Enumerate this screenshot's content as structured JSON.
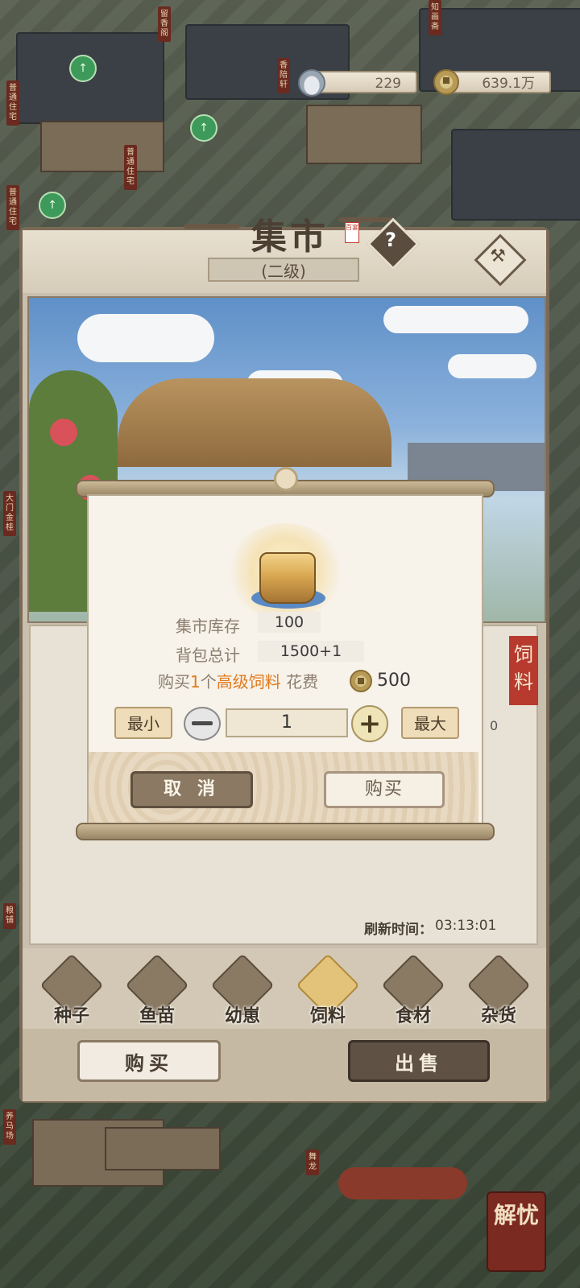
{
  "currency": {
    "silver": "229",
    "coins": "639.1万"
  },
  "map_signs": [
    "普通住宅",
    "普通住宅",
    "普通住宅",
    "香陪轩",
    "留香阁",
    "知画斋",
    "大门金桂",
    "粮铺",
    "养马场",
    "舞龙",
    "解忧"
  ],
  "market": {
    "title": "集市",
    "seal_text": "百宴",
    "level": "(二级)",
    "refresh_label": "刷新时间：",
    "refresh_time": "03:13:01",
    "side_tag": "饲料",
    "list_count_fragment": "0"
  },
  "tabs": [
    {
      "label": "种子",
      "icon": "seed-bag-icon",
      "active": false
    },
    {
      "label": "鱼苗",
      "icon": "fish-icon",
      "active": false
    },
    {
      "label": "幼崽",
      "icon": "piglet-icon",
      "active": false
    },
    {
      "label": "饲料",
      "icon": "feed-sack-icon",
      "active": true
    },
    {
      "label": "食材",
      "icon": "teapot-icon",
      "active": false
    },
    {
      "label": "杂货",
      "icon": "hammer-icon",
      "active": false
    }
  ],
  "bottom_buttons": {
    "buy": "购买",
    "sell": "出售"
  },
  "dialog": {
    "item_icon": "premium-feed-steamer-icon",
    "stock_label": "集市库存",
    "stock_value": "100",
    "bag_label": "背包总计",
    "bag_value": "1500+1",
    "buy_prefix": "购买",
    "buy_qty": "1",
    "buy_unit": "个",
    "item_name": "高级饲料",
    "cost_label": "花费",
    "cost_value": "500",
    "min_label": "最小",
    "max_label": "最大",
    "quantity": "1",
    "cancel_label": "取 消",
    "confirm_label": "购买"
  },
  "colors": {
    "highlight_orange": "#e07a1c",
    "active_tab": "#e3c27a",
    "panel_border": "#7a6a56"
  }
}
